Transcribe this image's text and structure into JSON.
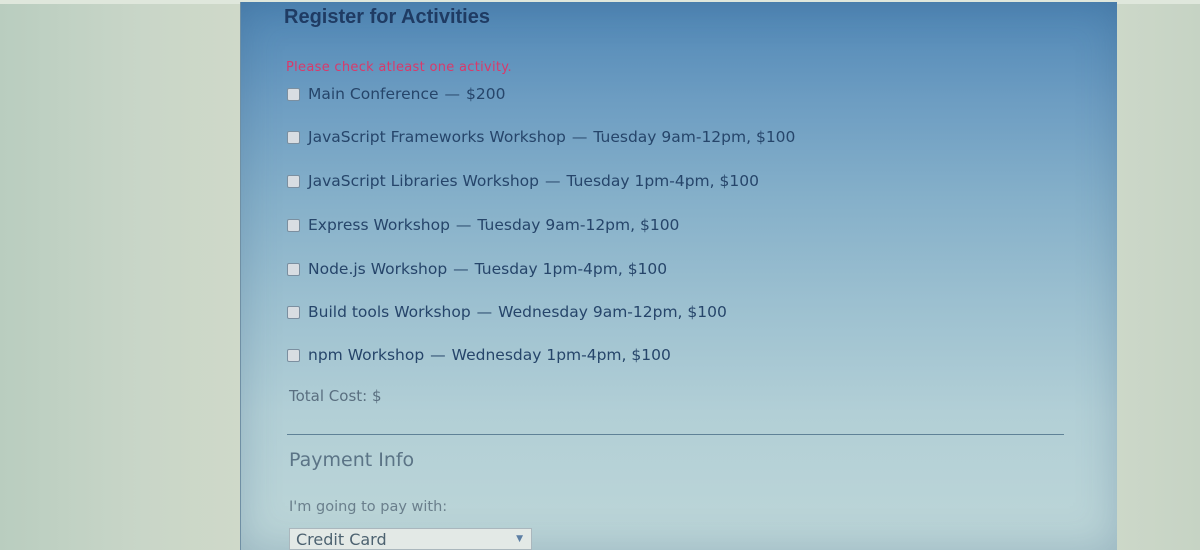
{
  "section": {
    "title": "Register for Activities",
    "warning": "Please check atleast one activity.",
    "activities": [
      {
        "name": "Main Conference",
        "detail": "$200",
        "checked": false
      },
      {
        "name": "JavaScript Frameworks Workshop",
        "detail": "Tuesday 9am-12pm, $100",
        "checked": false
      },
      {
        "name": "JavaScript Libraries Workshop",
        "detail": "Tuesday 1pm-4pm, $100",
        "checked": false
      },
      {
        "name": "Express Workshop",
        "detail": "Tuesday 9am-12pm, $100",
        "checked": false
      },
      {
        "name": "Node.js Workshop",
        "detail": "Tuesday 1pm-4pm, $100",
        "checked": false
      },
      {
        "name": "Build tools Workshop",
        "detail": "Wednesday 9am-12pm, $100",
        "checked": false
      },
      {
        "name": "npm Workshop",
        "detail": "Wednesday 1pm-4pm, $100",
        "checked": false
      }
    ],
    "dash": "—",
    "total_label": "Total Cost: $"
  },
  "payment": {
    "title": "Payment Info",
    "label": "I'm going to pay with:",
    "selected": "Credit Card",
    "arrow_icon": "chevron-down-icon"
  },
  "colors": {
    "warning": "#d9396a",
    "title": "#1f3b63",
    "panel_top": "#4f86b5",
    "panel_bottom": "#bdd6d8"
  }
}
